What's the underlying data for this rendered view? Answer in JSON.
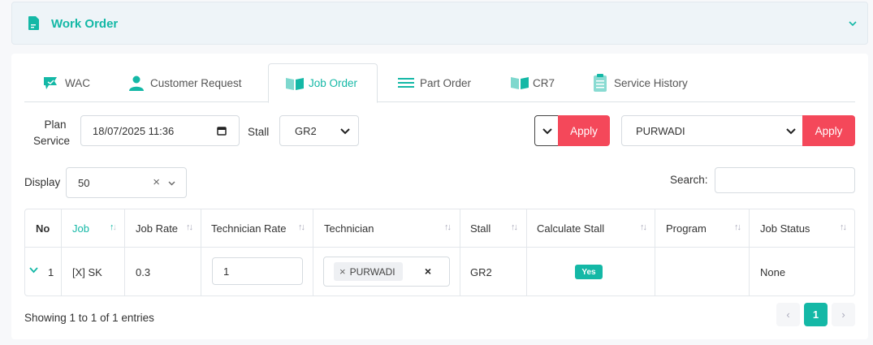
{
  "work_order": {
    "title": "Work Order"
  },
  "tabs": [
    {
      "label": "WAC",
      "icon": "megaphone-icon"
    },
    {
      "label": "Customer Request",
      "icon": "user-icon"
    },
    {
      "label": "Job Order",
      "icon": "book-open-icon",
      "active": true
    },
    {
      "label": "Part Order",
      "icon": "list-icon"
    },
    {
      "label": "CR7",
      "icon": "book-open-icon"
    },
    {
      "label": "Service History",
      "icon": "clipboard-icon"
    }
  ],
  "filters": {
    "plan_service_label": "Plan Service",
    "plan_service_label_line1": "Plan",
    "plan_service_label_line2": "Service",
    "plan_service_value": "18/07/2025 11:36",
    "stall_label": "Stall",
    "stall_value": "GR2",
    "apply_label_1": "Apply",
    "technician_value": "PURWADI",
    "apply_label_2": "Apply"
  },
  "display": {
    "label": "Display",
    "value": "50"
  },
  "search": {
    "label": "Search:",
    "value": ""
  },
  "table": {
    "columns": [
      "No",
      "Job",
      "Job Rate",
      "Technician Rate",
      "Technician",
      "Stall",
      "Calculate Stall",
      "Program",
      "Job Status"
    ],
    "rows": [
      {
        "no": "1",
        "job": "[X] SK",
        "job_rate": "0.3",
        "technician_rate": "1",
        "technician_tag": "PURWADI",
        "stall": "GR2",
        "calculate_stall": "Yes",
        "program": "",
        "job_status": "None"
      }
    ]
  },
  "footer": {
    "info": "Showing 1 to 1 of 1 entries",
    "current_page": "1"
  },
  "colors": {
    "accent": "#14b8a6",
    "apply": "#f4485a"
  }
}
